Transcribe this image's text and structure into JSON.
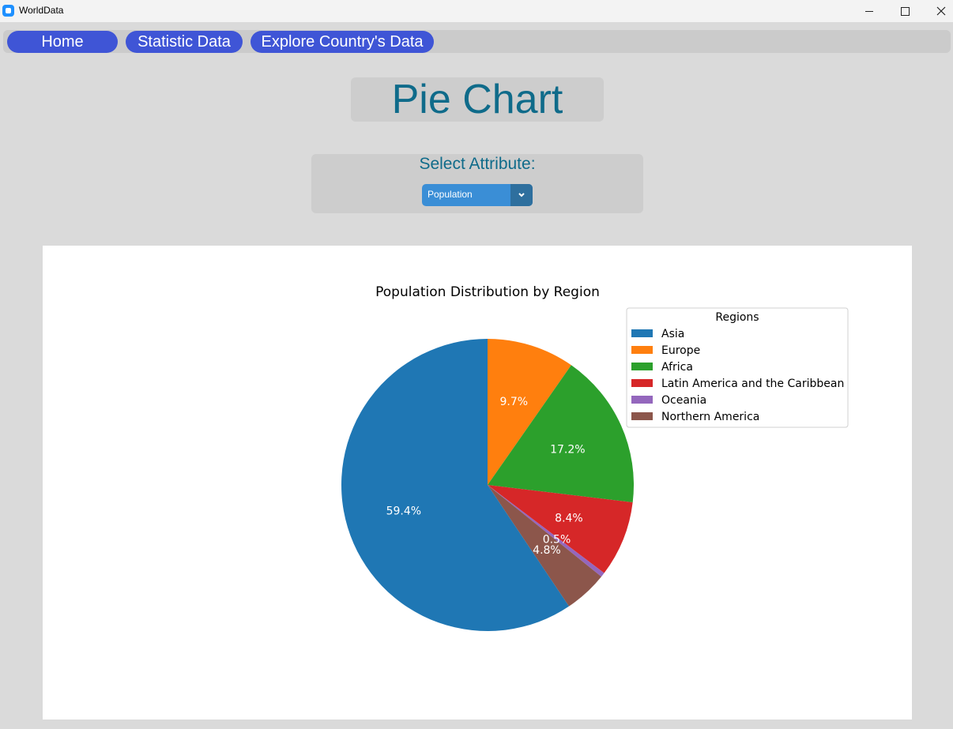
{
  "window": {
    "title": "WorldData"
  },
  "nav": {
    "home_label": "Home",
    "statistic_label": "Statistic Data",
    "explore_label": "Explore Country's Data"
  },
  "page": {
    "heading": "Pie Chart",
    "select_label": "Select Attribute:",
    "selected_attribute": "Population"
  },
  "colors": {
    "accent_nav": "#3f55d6",
    "heading_text": "#0f6b8a",
    "dropdown": "#3a8ed6"
  },
  "chart_data": {
    "type": "pie",
    "title": "Population Distribution by Region",
    "legend_title": "Regions",
    "legend_position": "upper-right",
    "start_angle_deg": 90,
    "direction": "clockwise",
    "categories": [
      "Europe",
      "Africa",
      "Latin America and the Caribbean",
      "Oceania",
      "Northern America",
      "Asia"
    ],
    "values": [
      9.7,
      17.2,
      8.4,
      0.5,
      4.8,
      59.4
    ],
    "labels": [
      "9.7%",
      "17.2%",
      "8.4%",
      "0.5%",
      "4.8%",
      "59.4%"
    ],
    "colors": [
      "#ff7f0e",
      "#2ca02c",
      "#d62728",
      "#9467bd",
      "#8c564b",
      "#1f77b4"
    ],
    "legend_entries": [
      {
        "name": "Asia",
        "color": "#1f77b4"
      },
      {
        "name": "Europe",
        "color": "#ff7f0e"
      },
      {
        "name": "Africa",
        "color": "#2ca02c"
      },
      {
        "name": "Latin America and the Caribbean",
        "color": "#d62728"
      },
      {
        "name": "Oceania",
        "color": "#9467bd"
      },
      {
        "name": "Northern America",
        "color": "#8c564b"
      }
    ]
  }
}
